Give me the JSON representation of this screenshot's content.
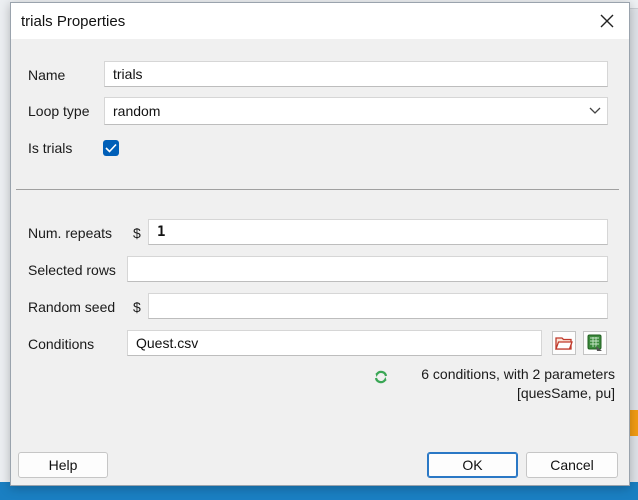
{
  "dialog": {
    "title": "trials Properties"
  },
  "fields": {
    "name": {
      "label": "Name",
      "value": "trials"
    },
    "loop_type": {
      "label": "Loop type",
      "value": "random"
    },
    "is_trials": {
      "label": "Is trials",
      "checked": true
    },
    "num_repeats": {
      "label": "Num. repeats",
      "prefix": "$",
      "value": "1"
    },
    "selected_rows": {
      "label": "Selected rows",
      "value": ""
    },
    "random_seed": {
      "label": "Random seed",
      "prefix": "$",
      "value": ""
    },
    "conditions": {
      "label": "Conditions",
      "value": "Quest.csv"
    }
  },
  "conditions_summary": {
    "line1": "6 conditions, with 2 parameters",
    "line2": "[quesSame, pu]"
  },
  "buttons": {
    "help": "Help",
    "ok": "OK",
    "cancel": "Cancel"
  },
  "colors": {
    "accent": "#005fb8",
    "refresh_green": "#3aa655"
  }
}
